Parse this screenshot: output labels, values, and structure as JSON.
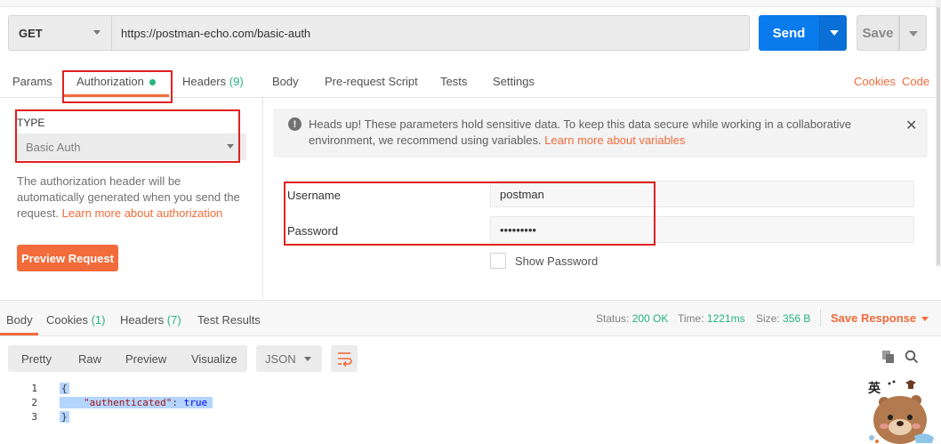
{
  "request": {
    "method": "GET",
    "url": "https://postman-echo.com/basic-auth",
    "send_label": "Send",
    "save_label": "Save"
  },
  "tabs": {
    "params": "Params",
    "authorization": "Authorization",
    "headers": "Headers",
    "headers_count": "(9)",
    "body": "Body",
    "prerequest": "Pre-request Script",
    "tests": "Tests",
    "settings": "Settings",
    "cookies": "Cookies",
    "code": "Code"
  },
  "auth": {
    "type_label": "TYPE",
    "type_value": "Basic Auth",
    "description": "The authorization header will be automatically generated when you send the request.",
    "learn_more": "Learn more about authorization",
    "preview_button": "Preview Request"
  },
  "notice": {
    "text": "Heads up! These parameters hold sensitive data. To keep this data secure while working in a collaborative environment, we recommend using variables.",
    "link": "Learn more about variables",
    "icon": "info-icon"
  },
  "fields": {
    "username_label": "Username",
    "username_value": "postman",
    "password_label": "Password",
    "password_value": "•••••••••",
    "show_password": "Show Password"
  },
  "response": {
    "tabs": {
      "body": "Body",
      "cookies": "Cookies",
      "cookies_count": "(1)",
      "headers": "Headers",
      "headers_count": "(7)",
      "test_results": "Test Results"
    },
    "status_label": "Status:",
    "status_value": "200 OK",
    "time_label": "Time:",
    "time_value": "1221ms",
    "size_label": "Size:",
    "size_value": "356 B",
    "save_response": "Save Response",
    "formats": [
      "Pretty",
      "Raw",
      "Preview",
      "Visualize"
    ],
    "language": "JSON",
    "code_lines": [
      {
        "num": "1",
        "text": "{"
      },
      {
        "num": "2",
        "key": "\"authenticated\"",
        "sep": ": ",
        "value": "true"
      },
      {
        "num": "3",
        "text": "}"
      }
    ]
  },
  "mascot": {
    "caption": "英"
  },
  "colors": {
    "accent_orange": "#f26b3a",
    "send_blue": "#097bed",
    "success_green": "#26b47f",
    "annotation_red": "#e02020"
  }
}
